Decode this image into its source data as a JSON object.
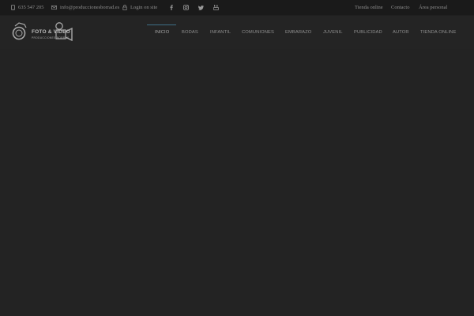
{
  "topbar": {
    "phone": "635 547 205",
    "email": "info@produccionesborrad.es",
    "login": "Login on site",
    "social": [
      {
        "icon": "facebook-icon",
        "glyph": "f"
      },
      {
        "icon": "instagram-icon",
        "glyph": ""
      },
      {
        "icon": "twitter-icon",
        "glyph": ""
      },
      {
        "icon": "youtube-icon",
        "glyph": ""
      }
    ],
    "links": [
      "Tienda online",
      "Contacto",
      "Área personal"
    ]
  },
  "logo": {
    "line1": "FOTO & VIDEO",
    "line2": "PRODUCCIONES BORRAS"
  },
  "nav": {
    "items": [
      "INICIO",
      "BODAS",
      "INFANTIL",
      "COMUNIONES",
      "EMBARAZO",
      "JUVENIL",
      "PUBLICIDAD",
      "AUTOR",
      "TIENDA ONLINE"
    ],
    "active": "INICIO",
    "accent_color": "#3e6f86"
  },
  "colors": {
    "topbar_bg": "#1a1a1a",
    "page_bg": "#242424"
  }
}
